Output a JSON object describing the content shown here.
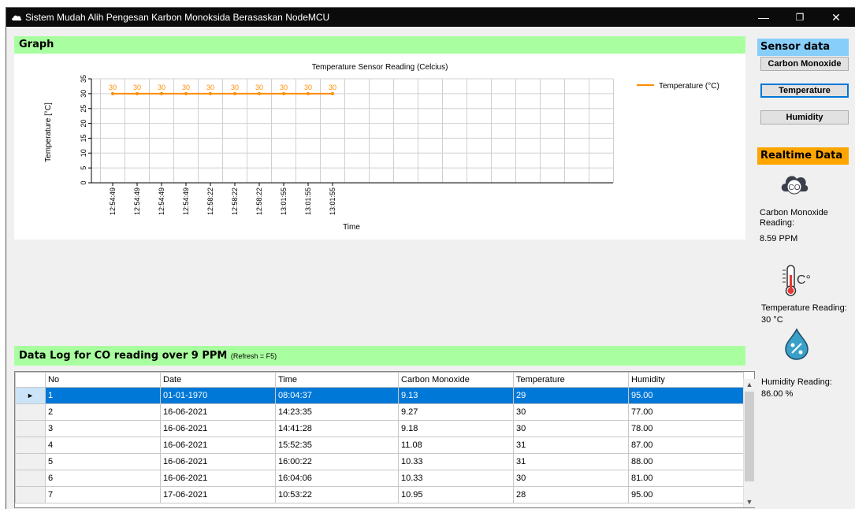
{
  "window": {
    "title": "Sistem Mudah Alih Pengesan Karbon Monoksida Berasaskan NodeMCU",
    "minimize_glyph": "—",
    "maximize_glyph": "❐",
    "close_glyph": "✕"
  },
  "graph": {
    "header": "Graph"
  },
  "chart_data": {
    "type": "line",
    "title": "Temperature Sensor Reading (Celcius)",
    "xlabel": "Time",
    "ylabel": "Temperature [°C]",
    "ylim": [
      0,
      35
    ],
    "yticks": [
      0,
      5,
      10,
      15,
      20,
      25,
      30,
      35
    ],
    "categories": [
      "12:54:49",
      "12:54:49",
      "12:54:49",
      "12:54:49",
      "12:58:22",
      "12:58:22",
      "12:58:22",
      "13:01:55",
      "13:01:55",
      "13:01:55"
    ],
    "series": [
      {
        "name": "Temperature (°C)",
        "values": [
          30,
          30,
          30,
          30,
          30,
          30,
          30,
          30,
          30,
          30
        ],
        "color": "#ff8c00"
      }
    ],
    "data_labels": true,
    "grid": true,
    "legend_position": "top-right"
  },
  "sidebar": {
    "sensor_header": "Sensor data",
    "buttons": [
      "Carbon Monoxide",
      "Temperature",
      "Humidity"
    ],
    "realtime_header": "Realtime Data",
    "co_icon_text": "CO",
    "co_label": "Carbon Monoxide Reading:",
    "co_value": "8.59 PPM",
    "temp_icon_text": "C°",
    "temp_label": "Temperature Reading:",
    "temp_value": "30 °C",
    "hum_label": "Humidity Reading:",
    "hum_value": "86.00 %"
  },
  "log": {
    "header": "Data Log for CO reading over 9 PPM",
    "refresh_hint": "(Refresh = F5)",
    "columns": [
      "No",
      "Date",
      "Time",
      "Carbon Monoxide",
      "Temperature",
      "Humidity"
    ],
    "rows": [
      [
        "1",
        "01-01-1970",
        "08:04:37",
        "9.13",
        "29",
        "95.00"
      ],
      [
        "2",
        "16-06-2021",
        "14:23:35",
        "9.27",
        "30",
        "77.00"
      ],
      [
        "3",
        "16-06-2021",
        "14:41:28",
        "9.18",
        "30",
        "78.00"
      ],
      [
        "4",
        "16-06-2021",
        "15:52:35",
        "11.08",
        "31",
        "87.00"
      ],
      [
        "5",
        "16-06-2021",
        "16:00:22",
        "10.33",
        "31",
        "88.00"
      ],
      [
        "6",
        "16-06-2021",
        "16:04:06",
        "10.33",
        "30",
        "81.00"
      ],
      [
        "7",
        "17-06-2021",
        "10:53:22",
        "10.95",
        "28",
        "95.00"
      ]
    ],
    "selected_row": 0
  },
  "colors": {
    "section_green": "#a9ff9f",
    "section_blue": "#87cefa",
    "section_orange": "#ffa500",
    "selection_blue": "#0078d7",
    "series_orange": "#ff8c00"
  }
}
